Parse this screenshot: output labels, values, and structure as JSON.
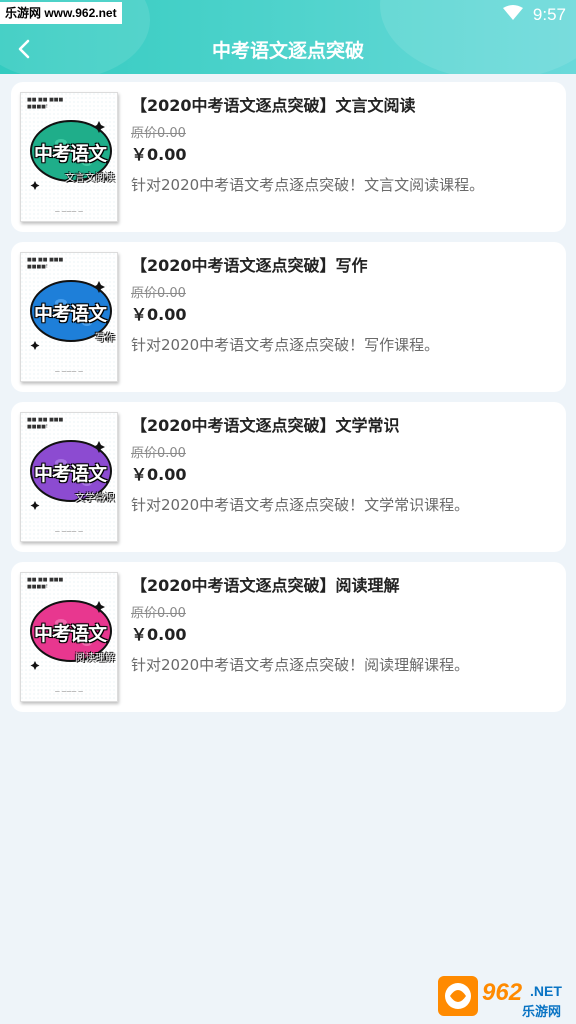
{
  "status_bar": {
    "watermark": "乐游网 www.962.net",
    "time": "9:57"
  },
  "header": {
    "title": "中考语文逐点突破",
    "back_icon": "chevron-left-icon"
  },
  "courses": [
    {
      "title": "【2020中考语文逐点突破】文言文阅读",
      "original_price": "原价0.00",
      "price": "￥0.00",
      "description": "针对2020中考语文考点逐点突破！文言文阅读课程。",
      "cover_big": "中考语文",
      "cover_sub": "文言文阅读",
      "cover_color": "#1fae8a"
    },
    {
      "title": "【2020中考语文逐点突破】写作",
      "original_price": "原价0.00",
      "price": "￥0.00",
      "description": "针对2020中考语文考点逐点突破！写作课程。",
      "cover_big": "中考语文",
      "cover_sub": "写作",
      "cover_color": "#1e7fd9"
    },
    {
      "title": "【2020中考语文逐点突破】文学常识",
      "original_price": "原价0.00",
      "price": "￥0.00",
      "description": "针对2020中考语文考点逐点突破！文学常识课程。",
      "cover_big": "中考语文",
      "cover_sub": "文学常识",
      "cover_color": "#8c4bd1"
    },
    {
      "title": "【2020中考语文逐点突破】阅读理解",
      "original_price": "原价0.00",
      "price": "￥0.00",
      "description": "针对2020中考语文考点逐点突破！阅读理解课程。",
      "cover_big": "中考语文",
      "cover_sub": "阅读理解",
      "cover_color": "#e8378f"
    }
  ],
  "watermark_bottom": {
    "number": "962",
    "net": ".NET",
    "site": "乐游网"
  },
  "colors": {
    "header_gradient_start": "#33cbc0",
    "header_gradient_end": "#6ad9da",
    "background": "#eef4f9"
  }
}
